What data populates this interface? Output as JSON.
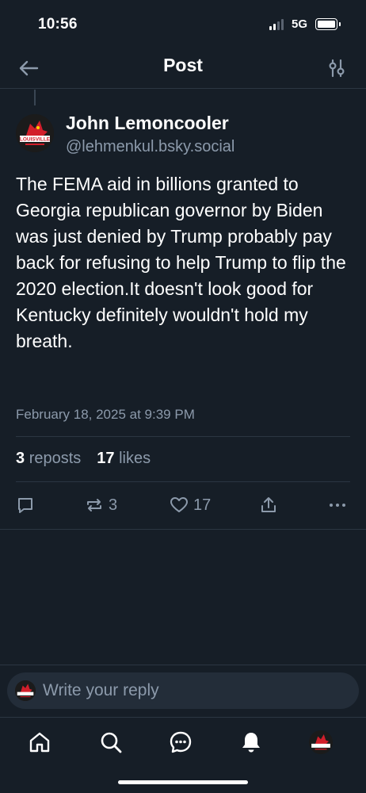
{
  "status_bar": {
    "time": "10:56",
    "network": "5G"
  },
  "header": {
    "title": "Post",
    "back_icon": "arrow-left-icon",
    "filter_icon": "sliders-icon"
  },
  "post": {
    "author_name": "John Lemoncooler",
    "author_handle": "@lehmenkul.bsky.social",
    "avatar_text": "LOUISVILLE",
    "text": "The FEMA aid in billions granted to Georgia republican governor by Biden was just denied by Trump probably pay back for refusing to help Trump to flip the 2020 election.It doesn't look good for Kentucky definitely wouldn't hold my breath.",
    "date": "February 18, 2025 at 9:39 PM",
    "reposts_count": "3",
    "reposts_label": "reposts",
    "likes_count": "17",
    "likes_label": "likes"
  },
  "actions": {
    "repost_count": "3",
    "like_count": "17"
  },
  "reply": {
    "placeholder": "Write your reply"
  },
  "tabs": [
    {
      "icon": "home-icon"
    },
    {
      "icon": "search-icon"
    },
    {
      "icon": "chat-icon"
    },
    {
      "icon": "bell-icon"
    },
    {
      "icon": "profile-avatar-icon"
    }
  ],
  "colors": {
    "background": "#161e27",
    "muted_text": "#8c9aab",
    "divider": "#2b3642",
    "reply_bar": "#232d39"
  }
}
